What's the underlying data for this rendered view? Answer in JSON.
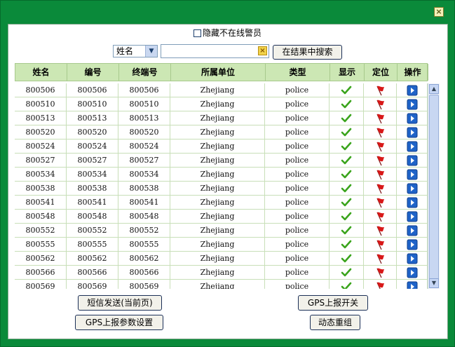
{
  "window": {
    "close_glyph": "×"
  },
  "filter": {
    "hide_offline_label": "隐藏不在线警员",
    "field_select_value": "姓名",
    "search_value": "",
    "search_button": "在结果中搜索"
  },
  "table": {
    "headers": [
      "姓名",
      "编号",
      "终端号",
      "所属单位",
      "类型",
      "显示",
      "定位",
      "操作"
    ],
    "rows": [
      [
        "800506",
        "800506",
        "800506",
        "Zhejiang",
        "police"
      ],
      [
        "800510",
        "800510",
        "800510",
        "Zhejiang",
        "police"
      ],
      [
        "800513",
        "800513",
        "800513",
        "Zhejiang",
        "police"
      ],
      [
        "800520",
        "800520",
        "800520",
        "Zhejiang",
        "police"
      ],
      [
        "800524",
        "800524",
        "800524",
        "Zhejiang",
        "police"
      ],
      [
        "800527",
        "800527",
        "800527",
        "Zhejiang",
        "police"
      ],
      [
        "800534",
        "800534",
        "800534",
        "Zhejiang",
        "police"
      ],
      [
        "800538",
        "800538",
        "800538",
        "Zhejiang",
        "police"
      ],
      [
        "800541",
        "800541",
        "800541",
        "Zhejiang",
        "police"
      ],
      [
        "800548",
        "800548",
        "800548",
        "Zhejiang",
        "police"
      ],
      [
        "800552",
        "800552",
        "800552",
        "Zhejiang",
        "police"
      ],
      [
        "800555",
        "800555",
        "800555",
        "Zhejiang",
        "police"
      ],
      [
        "800562",
        "800562",
        "800562",
        "Zhejiang",
        "police"
      ],
      [
        "800566",
        "800566",
        "800566",
        "Zhejiang",
        "police"
      ],
      [
        "800569",
        "800569",
        "800569",
        "Zhejiang",
        "police"
      ]
    ],
    "icons": {
      "show": "checkmark-icon",
      "locate": "red-flag-icon",
      "action": "play-arrow-icon"
    }
  },
  "buttons": {
    "sms_send": "短信发送(当前页)",
    "gps_toggle": "GPS上报开关",
    "gps_params": "GPS上报参数设置",
    "regroup": "动态重组"
  },
  "colors": {
    "frame": "#0a8a3a",
    "header_bg": "#cce7b4",
    "check": "#3aa41c",
    "flag": "#d81818",
    "action": "#1f63c8"
  }
}
